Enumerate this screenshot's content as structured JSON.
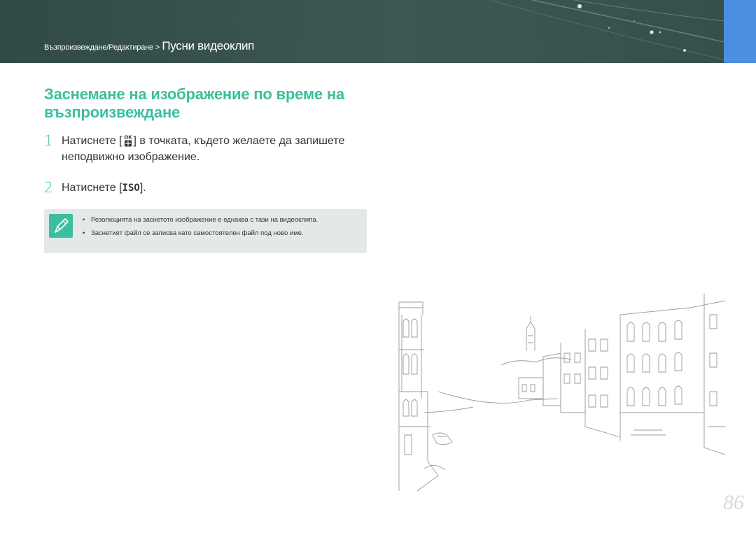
{
  "header": {
    "breadcrumb_path": "Възпроизвеждане/Редактиране",
    "breadcrumb_separator": ">",
    "breadcrumb_current": "Пусни видеоклип"
  },
  "section_title": "Заснемане на изображение по време на възпроизвеждане",
  "steps": [
    {
      "number": "1",
      "text_before": "Натиснете [",
      "key_icon": "ok-button-icon",
      "text_after": "] в точката, където желаете да запишете неподвижно изображение."
    },
    {
      "number": "2",
      "text_before": "Натиснете [",
      "key": "ISO",
      "text_after": "]."
    }
  ],
  "note": {
    "icon": "pencil-note-icon",
    "items": [
      "Резолюцията на заснетото изображение е еднаква с тази на видеоклипа.",
      "Заснетият файл се записва като самостоятелен файл под ново име."
    ]
  },
  "illustration": "venice-canal-line-drawing",
  "page_number": "86",
  "colors": {
    "accent": "#3bbf9e",
    "header_bg": "#3d5754",
    "tab_blue": "#4a8fe0",
    "note_bg": "#e3e8e9"
  }
}
